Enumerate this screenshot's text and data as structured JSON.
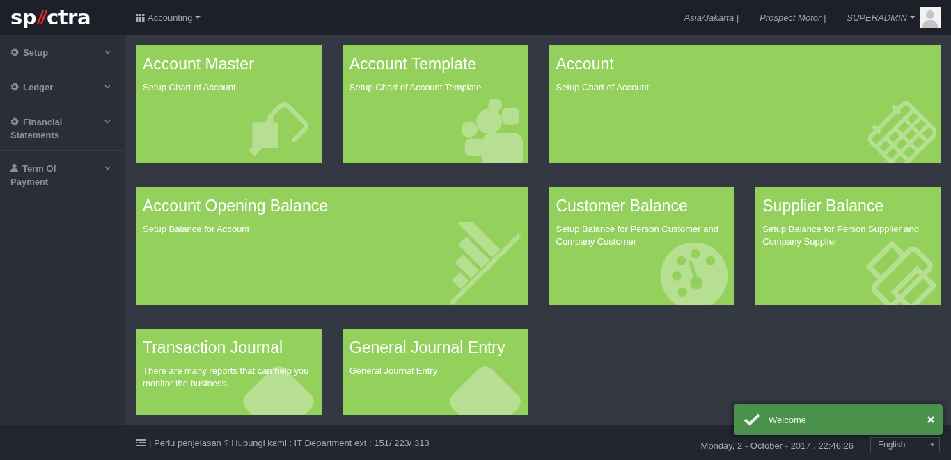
{
  "topbar": {
    "logo": {
      "left": "sp",
      "right": "ctra"
    },
    "module": "Accounting",
    "timezone": "Asia/Jakarta |",
    "company": "Prospect Motor |",
    "user": "SUPERADMIN"
  },
  "sidebar": {
    "sections": [
      {
        "items": [
          {
            "label": "Setup",
            "kind": "settings"
          },
          {
            "label": "Ledger",
            "kind": "settings"
          },
          {
            "label": "Financial Statements",
            "kind": "settings"
          }
        ]
      },
      {
        "items": [
          {
            "label": "Term Of Payment",
            "kind": "person"
          }
        ]
      }
    ]
  },
  "tiles": [
    {
      "title": "Account Master",
      "description": "Setup Chart of Account",
      "kind": "arrow"
    },
    {
      "title": "Account Template",
      "description": "Setup Chart of Account Template",
      "kind": "people"
    },
    {
      "title": "Account",
      "description": "Setup Chart of Account",
      "kind": "calendar"
    },
    {
      "title": "Account Opening Balance",
      "description": "Setup Balance for Account",
      "kind": "chart"
    },
    {
      "title": "Customer Balance",
      "description": "Setup Balance for Person Customer and Company Customer",
      "kind": "dashboard"
    },
    {
      "title": "Supplier Balance",
      "description": "Setup Balance for Person Supplier and Company Supplier",
      "kind": "printer"
    },
    {
      "title": "Transaction Journal",
      "description": "There are many reports that can help you monitor the business.",
      "kind": "diamond"
    },
    {
      "title": "General Journal Entry",
      "description": "General Journal Entry",
      "kind": "diamond"
    }
  ],
  "footer": {
    "help": "| Perlu penjelasan ? Hubungi kami : IT Department ext : 151/ 223/ 313",
    "datetime": "Monday, 2 - October - 2017 . 22:46:26",
    "language": "English",
    "dropdown_glyph": "▼"
  },
  "toast": {
    "message": "Welcome"
  }
}
